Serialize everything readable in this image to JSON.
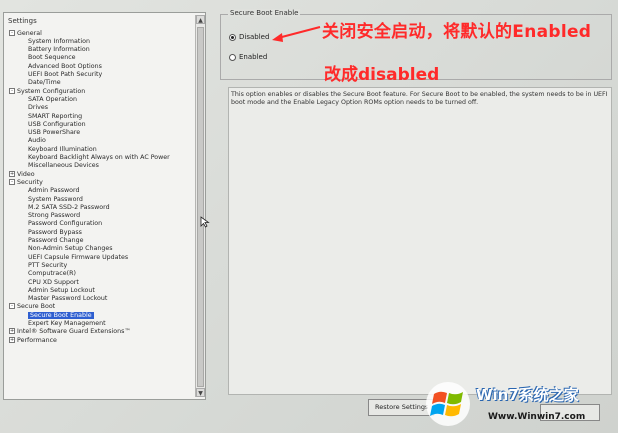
{
  "tree": {
    "title": "Settings",
    "items": [
      {
        "label": "General",
        "level": 0,
        "toggle": "-"
      },
      {
        "label": "System Information",
        "level": 1
      },
      {
        "label": "Battery Information",
        "level": 1
      },
      {
        "label": "Boot Sequence",
        "level": 1
      },
      {
        "label": "Advanced Boot Options",
        "level": 1
      },
      {
        "label": "UEFI Boot Path Security",
        "level": 1
      },
      {
        "label": "Date/Time",
        "level": 1
      },
      {
        "label": "System Configuration",
        "level": 0,
        "toggle": "-"
      },
      {
        "label": "SATA Operation",
        "level": 1
      },
      {
        "label": "Drives",
        "level": 1
      },
      {
        "label": "SMART Reporting",
        "level": 1
      },
      {
        "label": "USB Configuration",
        "level": 1
      },
      {
        "label": "USB PowerShare",
        "level": 1
      },
      {
        "label": "Audio",
        "level": 1
      },
      {
        "label": "Keyboard Illumination",
        "level": 1
      },
      {
        "label": "Keyboard Backlight Always on with AC Power",
        "level": 1
      },
      {
        "label": "Miscellaneous Devices",
        "level": 1
      },
      {
        "label": "Video",
        "level": 0,
        "toggle": "+"
      },
      {
        "label": "Security",
        "level": 0,
        "toggle": "-"
      },
      {
        "label": "Admin Password",
        "level": 1
      },
      {
        "label": "System Password",
        "level": 1
      },
      {
        "label": "M.2 SATA SSD-2 Password",
        "level": 1
      },
      {
        "label": "Strong Password",
        "level": 1
      },
      {
        "label": "Password Configuration",
        "level": 1
      },
      {
        "label": "Password Bypass",
        "level": 1
      },
      {
        "label": "Password Change",
        "level": 1
      },
      {
        "label": "Non-Admin Setup Changes",
        "level": 1
      },
      {
        "label": "UEFI Capsule Firmware Updates",
        "level": 1
      },
      {
        "label": "PTT Security",
        "level": 1
      },
      {
        "label": "Computrace(R)",
        "level": 1
      },
      {
        "label": "CPU XD Support",
        "level": 1
      },
      {
        "label": "Admin Setup Lockout",
        "level": 1
      },
      {
        "label": "Master Password Lockout",
        "level": 1
      },
      {
        "label": "Secure Boot",
        "level": 0,
        "toggle": "-"
      },
      {
        "label": "Secure Boot Enable",
        "level": 1,
        "selected": true
      },
      {
        "label": "Expert Key Management",
        "level": 1
      },
      {
        "label": "Intel® Software Guard Extensions™",
        "level": 0,
        "toggle": "+"
      },
      {
        "label": "Performance",
        "level": 0,
        "toggle": "+"
      }
    ]
  },
  "secure_boot": {
    "group_title": "Secure Boot Enable",
    "options": [
      {
        "label": "Disabled",
        "selected": true
      },
      {
        "label": "Enabled",
        "selected": false
      }
    ],
    "description": "This option enables or disables the Secure Boot feature. For Secure Boot to be enabled, the system needs to be in UEFI boot mode and the Enable Legacy Option ROMs option needs to be turned off."
  },
  "buttons": {
    "restore": "Restore Settings"
  },
  "annotation": {
    "line1": "关闭安全启动，将默认的Enabled",
    "line2": "改成disabled",
    "color": "#ff2a2a"
  },
  "watermark": {
    "brand": "Win7系统之家",
    "url": "Www.Winwin7.com"
  }
}
